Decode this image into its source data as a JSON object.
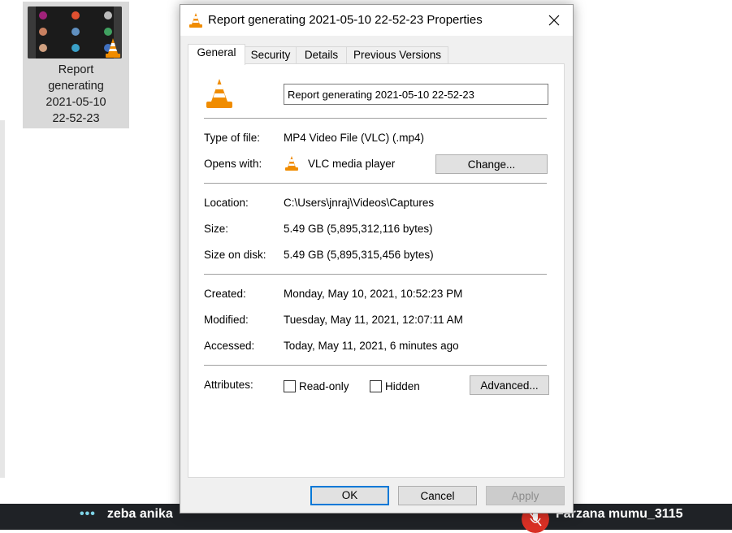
{
  "desktop_file": {
    "label_lines": [
      "Report",
      "generating",
      "2021-05-10",
      "22-52-23"
    ]
  },
  "dialog": {
    "title": "Report generating 2021-05-10 22-52-23 Properties",
    "tabs": [
      {
        "label": "General",
        "active": true
      },
      {
        "label": "Security",
        "active": false
      },
      {
        "label": "Details",
        "active": false
      },
      {
        "label": "Previous Versions",
        "active": false
      }
    ],
    "general": {
      "file_name": "Report generating 2021-05-10 22-52-23",
      "type_label": "Type of file:",
      "type_value": "MP4 Video File (VLC) (.mp4)",
      "opens_label": "Opens with:",
      "opens_value": "VLC media player",
      "change_button": "Change...",
      "location_label": "Location:",
      "location_value": "C:\\Users\\jnraj\\Videos\\Captures",
      "size_label": "Size:",
      "size_value": "5.49 GB (5,895,312,116 bytes)",
      "size_disk_label": "Size on disk:",
      "size_disk_value": "5.49 GB (5,895,315,456 bytes)",
      "created_label": "Created:",
      "created_value": "Monday, May 10, 2021, 10:52:23 PM",
      "modified_label": "Modified:",
      "modified_value": "Tuesday, May 11, 2021, 12:07:11 AM",
      "accessed_label": "Accessed:",
      "accessed_value": "Today, May 11, 2021, 6 minutes ago",
      "attributes_label": "Attributes:",
      "readonly_label": "Read-only",
      "readonly_checked": false,
      "hidden_label": "Hidden",
      "hidden_checked": false,
      "advanced_button": "Advanced..."
    },
    "buttons": {
      "ok": "OK",
      "cancel": "Cancel",
      "apply": "Apply"
    }
  },
  "taskbar": {
    "left_name": "zeba anika",
    "right_name": "Farzana mumu_3115"
  },
  "colors": {
    "accent": "#0078d7",
    "vlc_orange": "#f08c00",
    "mic_red": "#d93025"
  },
  "icons": [
    "vlc-cone-icon",
    "close-icon",
    "more-dots-icon",
    "mic-off-icon"
  ]
}
